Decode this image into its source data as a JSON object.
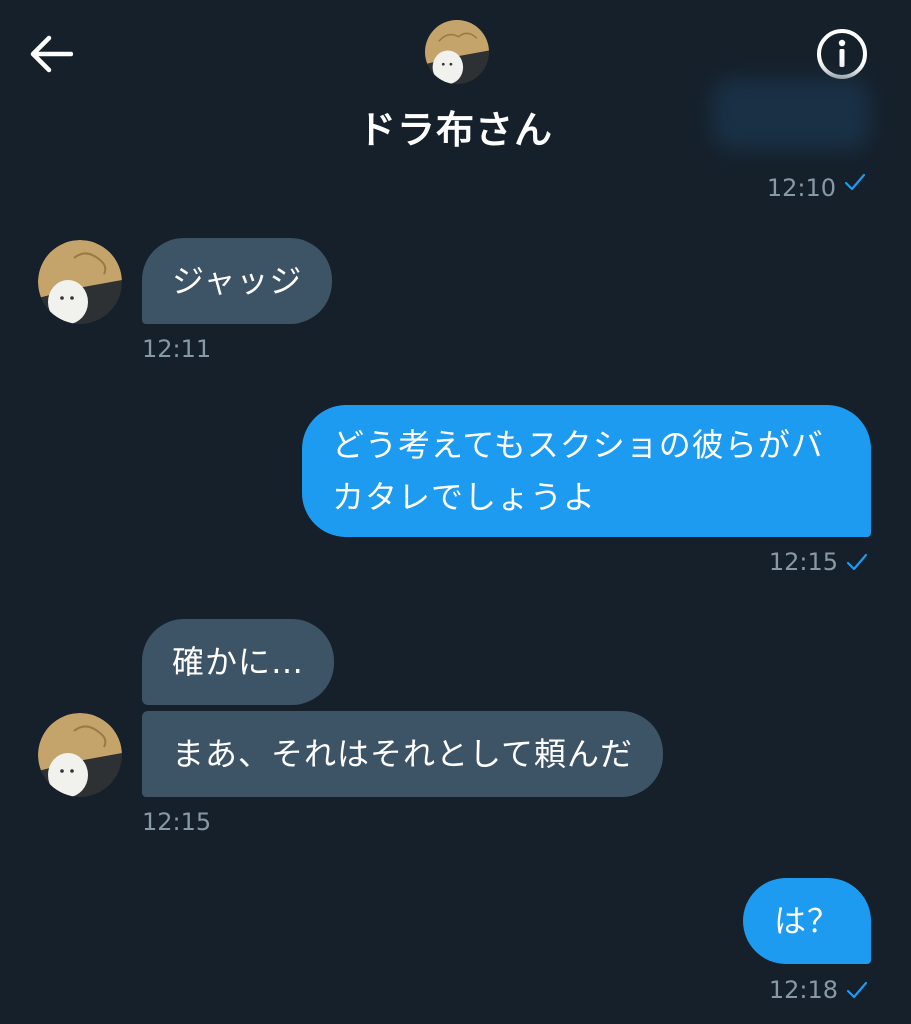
{
  "header": {
    "title": "ドラ布さん",
    "back_icon": "arrow-left-icon",
    "info_icon": "info-circle-icon"
  },
  "partial_previous": {
    "time": "12:10"
  },
  "messages": [
    {
      "direction": "in",
      "text": "ジャッジ",
      "time": "12:11"
    },
    {
      "direction": "out",
      "text": "どう考えてもスクショの彼らがバカタレでしょうよ",
      "time": "12:15"
    },
    {
      "direction": "in",
      "text": "確かに…"
    },
    {
      "direction": "in",
      "text": "まあ、それはそれとして頼んだ",
      "time": "12:15"
    },
    {
      "direction": "out",
      "text": "は？",
      "time": "12:18"
    }
  ],
  "colors": {
    "background": "#15202b",
    "incoming_bubble": "#3d5466",
    "outgoing_bubble": "#1d9bf0",
    "timestamp": "#8899a6",
    "read_check": "#1d9bf0"
  }
}
